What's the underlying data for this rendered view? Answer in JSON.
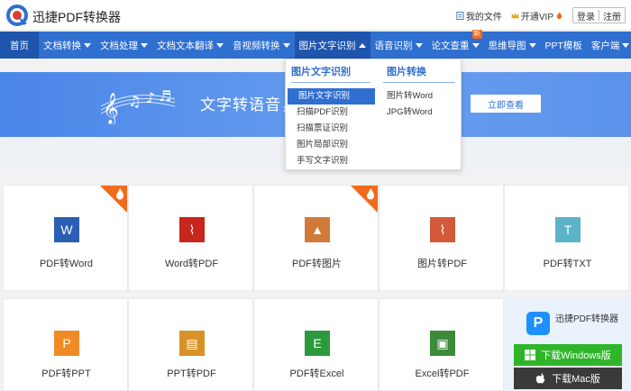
{
  "header": {
    "brand": "迅捷PDF转换器",
    "my_files": "我的文件",
    "vip": "开通VIP",
    "login": "登录",
    "register": "注册"
  },
  "nav": {
    "items": [
      {
        "label": "首页"
      },
      {
        "label": "文档转换"
      },
      {
        "label": "文档处理"
      },
      {
        "label": "文档文本翻译"
      },
      {
        "label": "音视频转换"
      },
      {
        "label": "图片文字识别"
      },
      {
        "label": "语音识别"
      },
      {
        "label": "论文查重",
        "badge": "新"
      },
      {
        "label": "思维导图"
      },
      {
        "label": "PPT模板"
      },
      {
        "label": "客户端"
      }
    ]
  },
  "dropdown": {
    "col1": {
      "title": "图片文字识别",
      "items": [
        "图片文字识别",
        "扫描PDF识别",
        "扫描票证识别",
        "图片局部识别",
        "手写文字识别"
      ]
    },
    "col2": {
      "title": "图片转换",
      "items": [
        "图片转Word",
        "JPG转Word"
      ]
    }
  },
  "banner": {
    "text": "文字转语音，",
    "button": "立即查看"
  },
  "tiles": [
    {
      "label": "PDF转Word",
      "glyph": "W",
      "color": "#2b5fb4",
      "hot": true
    },
    {
      "label": "Word转PDF",
      "glyph": "⌇",
      "color": "#c8251d",
      "hot": false
    },
    {
      "label": "PDF转图片",
      "glyph": "▲",
      "color": "#d07a3a",
      "hot": true
    },
    {
      "label": "图片转PDF",
      "glyph": "⌇",
      "color": "#d25a3a",
      "hot": false
    },
    {
      "label": "PDF转TXT",
      "glyph": "T",
      "color": "#5bb3c8",
      "hot": false
    },
    {
      "label": "PDF转PPT",
      "glyph": "P",
      "color": "#f08a24",
      "hot": false
    },
    {
      "label": "PPT转PDF",
      "glyph": "▤",
      "color": "#d9922a",
      "hot": false
    },
    {
      "label": "PDF转Excel",
      "glyph": "E",
      "color": "#2c9a3c",
      "hot": false
    },
    {
      "label": "Excel转PDF",
      "glyph": "▣",
      "color": "#3d8a3a",
      "hot": false
    }
  ],
  "download": {
    "app_name": "迅捷PDF转换器",
    "windows": "下载Windows版",
    "mac": "下载Mac版"
  },
  "colors": {
    "nav": "#2f6fd0",
    "nav_active": "#1f55ad",
    "hot": "#f26a1b"
  }
}
